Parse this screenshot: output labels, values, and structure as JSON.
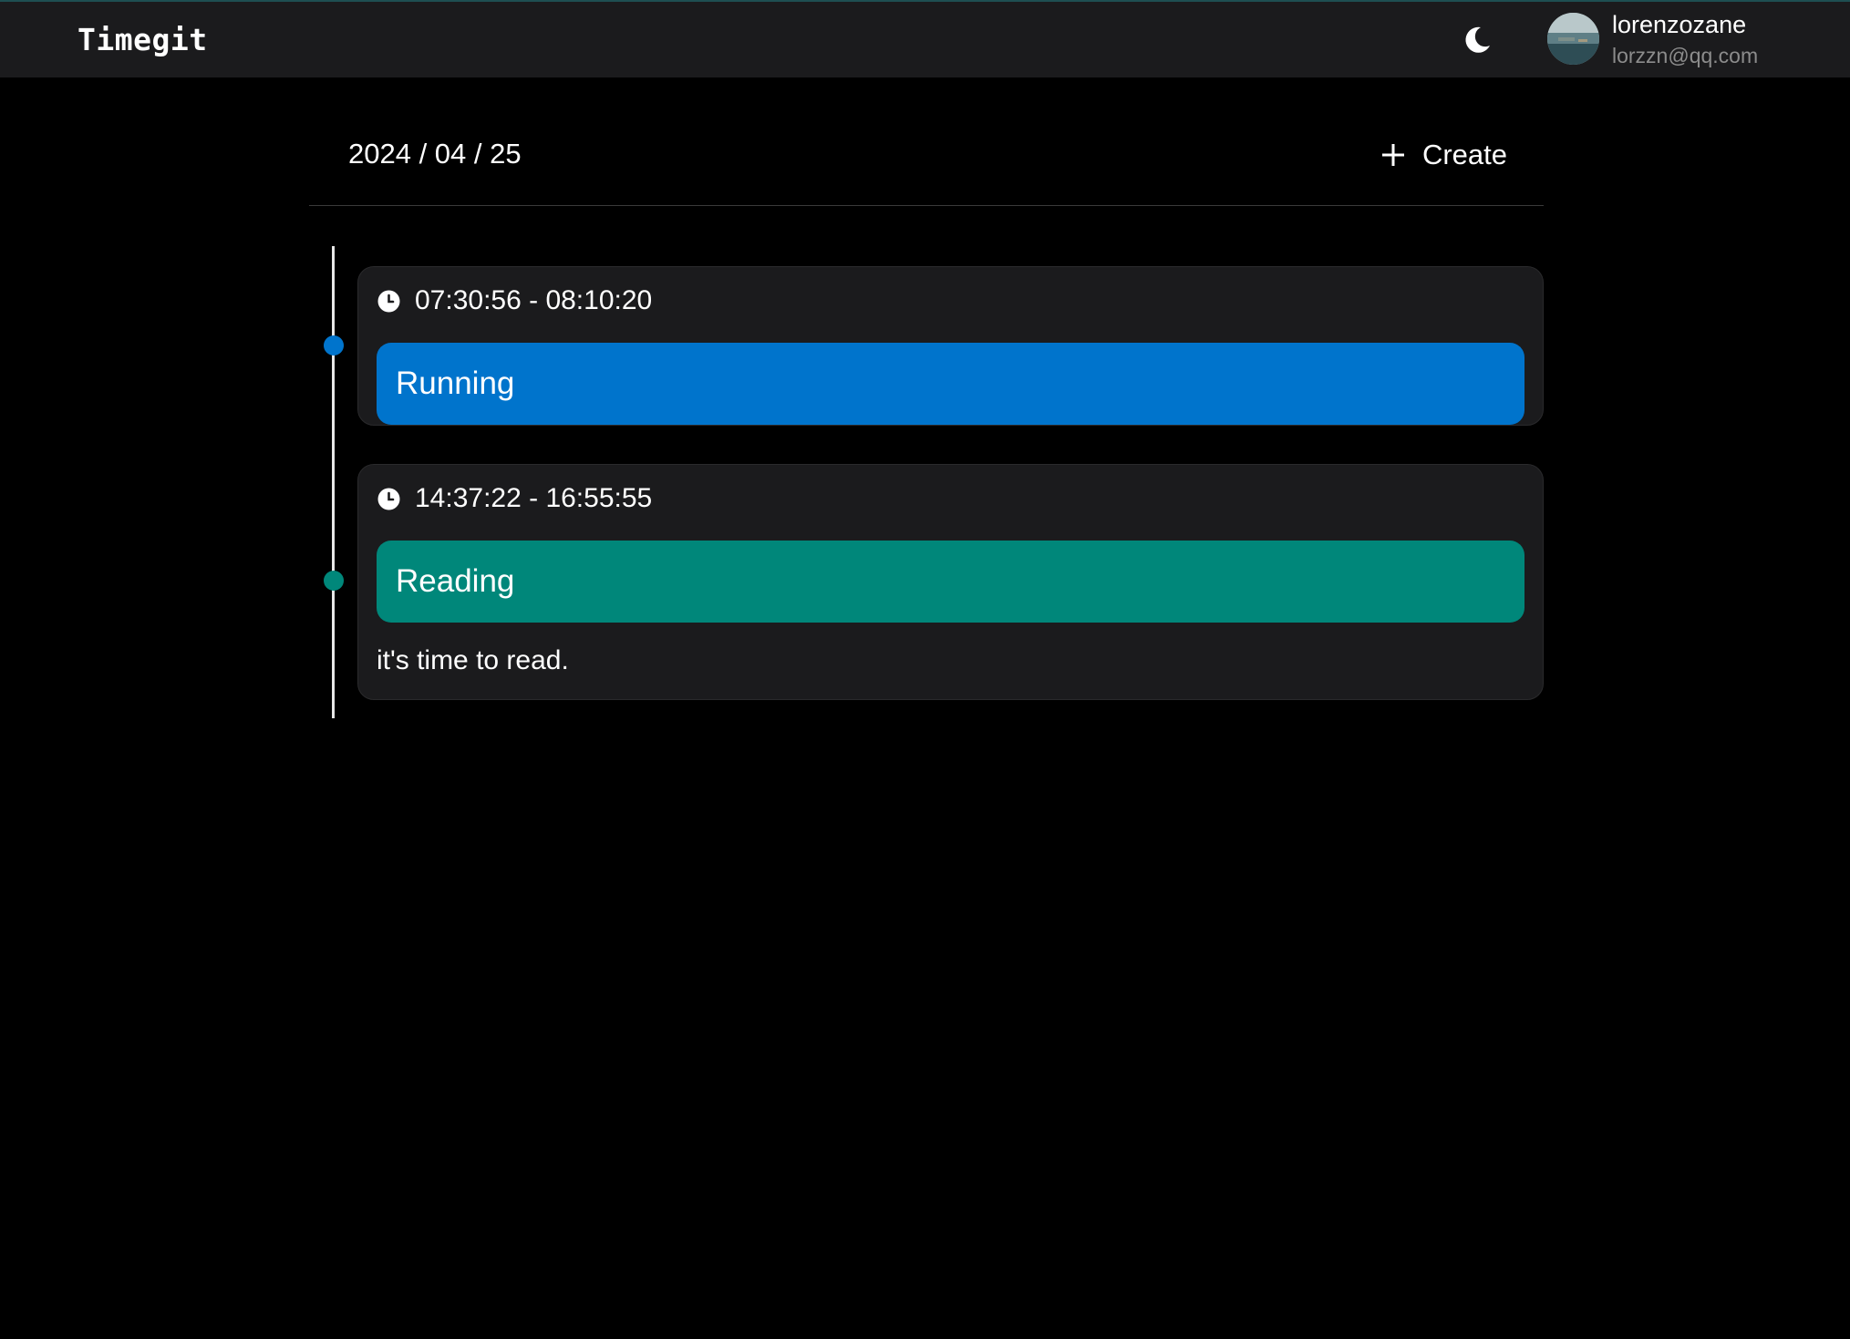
{
  "app": {
    "title": "Timegit"
  },
  "user": {
    "name": "lorenzozane",
    "email": "lorzzn@qq.com",
    "avatar_icon": "avatar-image"
  },
  "theme": {
    "toggle_icon": "moon-icon"
  },
  "header": {
    "date": "2024 / 04 / 25",
    "create_label": "Create"
  },
  "entries": [
    {
      "time": "07:30:56 - 08:10:20",
      "tag": "Running",
      "color": "#0074cc",
      "note": ""
    },
    {
      "time": "14:37:22 - 16:55:55",
      "tag": "Reading",
      "color": "#00877a",
      "note": "it's time to read."
    }
  ]
}
